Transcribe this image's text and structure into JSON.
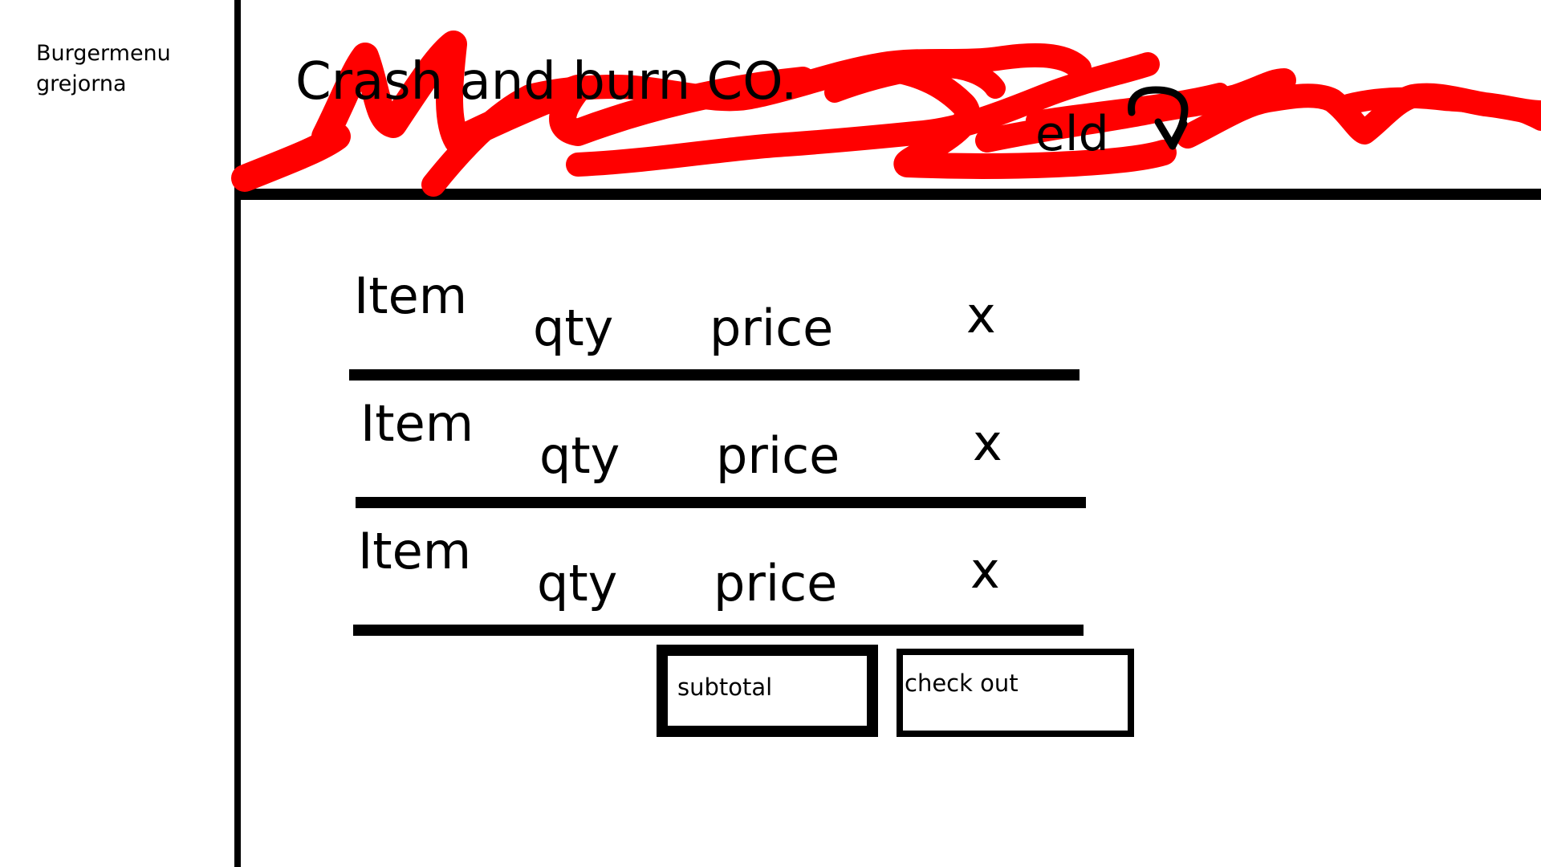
{
  "sidebar": {
    "line1": "Burgermenu",
    "line2": "grejorna"
  },
  "header": {
    "title": "Crash and burn CO.",
    "suffix_text": "eld",
    "scribble_color": "#ff0000",
    "arrow_icon": "curved-arrow-icon"
  },
  "cart": {
    "rows": [
      {
        "item": "Item",
        "qty": "qty",
        "price": "price",
        "remove": "x"
      },
      {
        "item": "Item",
        "qty": "qty",
        "price": "price",
        "remove": "x"
      },
      {
        "item": "Item",
        "qty": "qty",
        "price": "price",
        "remove": "x"
      }
    ]
  },
  "footer": {
    "subtotal_label": "subtotal",
    "checkout_label": "check out"
  }
}
